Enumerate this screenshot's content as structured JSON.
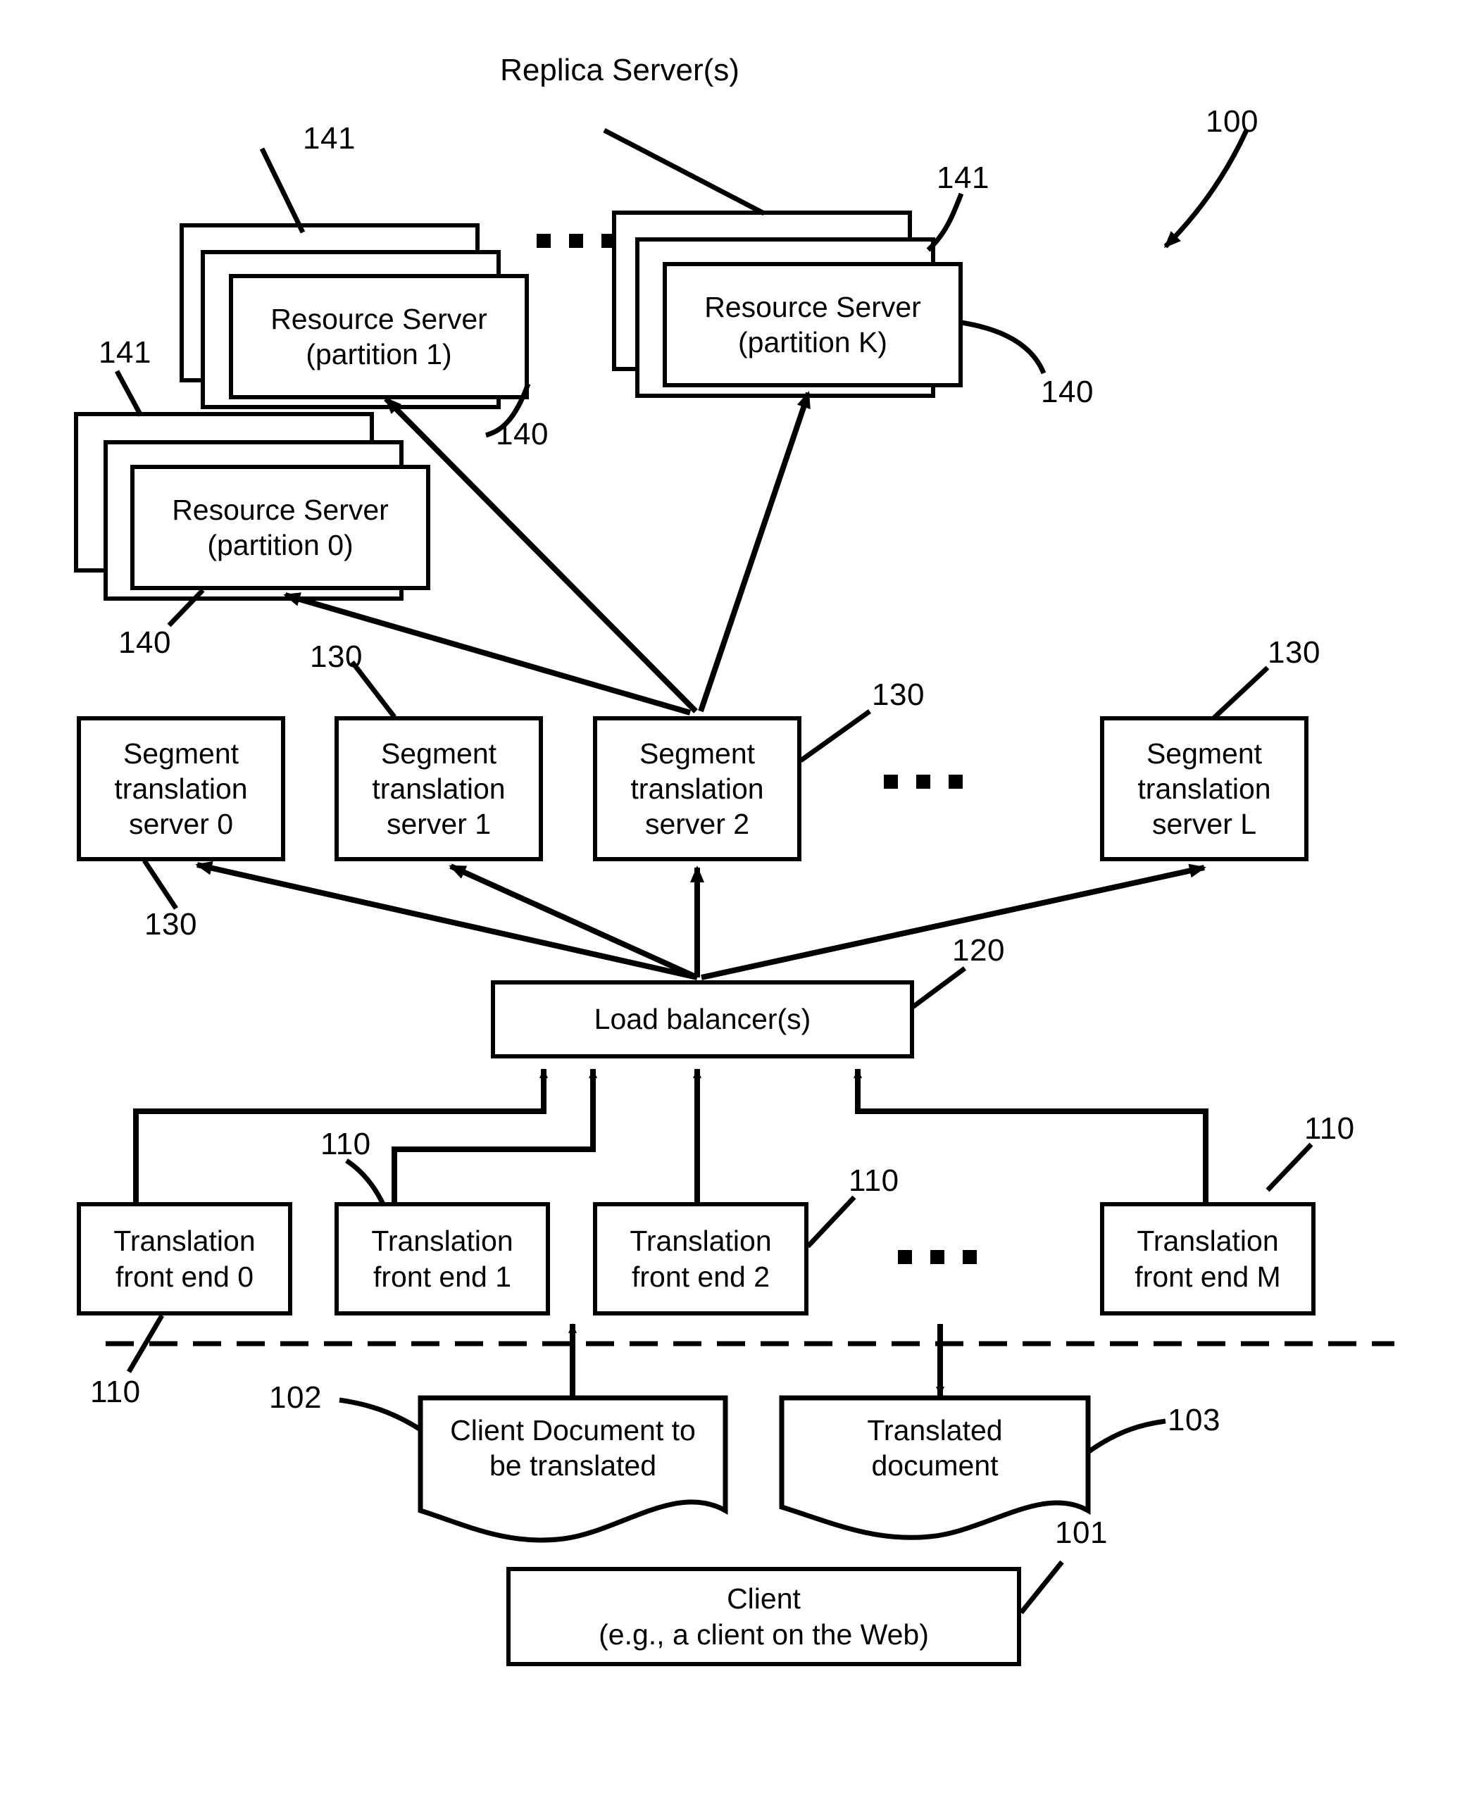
{
  "figure": {
    "title_ref": "100",
    "group_label": "Replica Server(s)"
  },
  "resource_servers": [
    {
      "line1": "Resource Server",
      "line2": "(partition 1)",
      "stack_ref": "141",
      "box_ref": "140"
    },
    {
      "line1": "Resource Server",
      "line2": "(partition K)",
      "stack_ref": "141",
      "box_ref": "140"
    },
    {
      "line1": "Resource Server",
      "line2": "(partition 0)",
      "stack_ref": "141",
      "box_ref": "140"
    }
  ],
  "segment_servers": [
    {
      "line1": "Segment",
      "line2": "translation",
      "line3": "server 0",
      "ref": "130"
    },
    {
      "line1": "Segment",
      "line2": "translation",
      "line3": "server 1",
      "ref": "130"
    },
    {
      "line1": "Segment",
      "line2": "translation",
      "line3": "server 2",
      "ref": "130"
    },
    {
      "line1": "Segment",
      "line2": "translation",
      "line3": "server L",
      "ref": "130"
    }
  ],
  "load_balancer": {
    "label": "Load balancer(s)",
    "ref": "120"
  },
  "front_ends": [
    {
      "line1": "Translation",
      "line2": "front end 0",
      "ref": "110"
    },
    {
      "line1": "Translation",
      "line2": "front end 1",
      "ref": "110"
    },
    {
      "line1": "Translation",
      "line2": "front end 2",
      "ref": "110"
    },
    {
      "line1": "Translation",
      "line2": "front end M",
      "ref": "110"
    }
  ],
  "documents": {
    "input": {
      "line1": "Client Document to",
      "line2": "be translated",
      "ref": "102"
    },
    "output": {
      "line1": "Translated",
      "line2": "document",
      "ref": "103"
    }
  },
  "client": {
    "line1": "Client",
    "line2": "(e.g., a client on the Web)",
    "ref": "101"
  },
  "ellipses": {
    "top": "■ ■ ■",
    "middle": "■ ■ ■",
    "bottom": "■ ■ ■"
  },
  "colors": {
    "stroke": "#000000",
    "background": "#ffffff"
  }
}
